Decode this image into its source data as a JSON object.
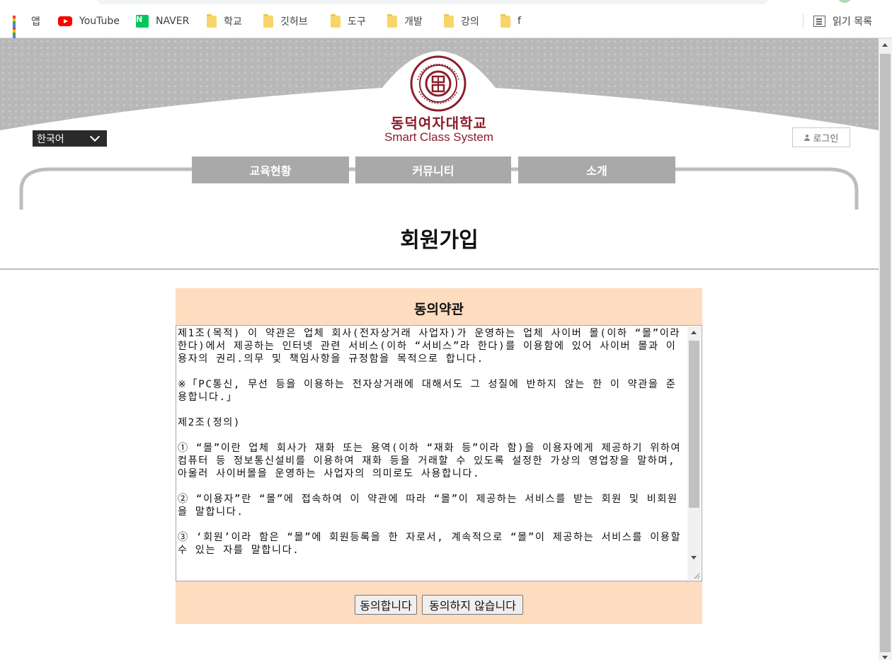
{
  "browser": {
    "bookmarks": [
      {
        "label": "앱",
        "icon": "apps-grid-icon"
      },
      {
        "label": "YouTube",
        "icon": "youtube-icon"
      },
      {
        "label": "NAVER",
        "icon": "naver-icon"
      },
      {
        "label": "학교",
        "icon": "folder-icon"
      },
      {
        "label": "깃허브",
        "icon": "folder-icon"
      },
      {
        "label": "도구",
        "icon": "folder-icon"
      },
      {
        "label": "개발",
        "icon": "folder-icon"
      },
      {
        "label": "강의",
        "icon": "folder-icon"
      },
      {
        "label": "f",
        "icon": "folder-icon"
      }
    ],
    "reading_list": "읽기 목록"
  },
  "header": {
    "school_name": "동덕여자대학교",
    "system_name": "Smart Class System",
    "language": "한국어",
    "login_label": "로그인",
    "nav": [
      "교육현황",
      "커뮤니티",
      "소개"
    ]
  },
  "page": {
    "title": "회원가입"
  },
  "agreement": {
    "title": "동의약관",
    "terms_text": "제1조(목적) 이 약관은 업체 회사(전자상거래 사업자)가 운영하는 업체 사이버 몰(이하 “몰”이라 한다)에서 제공하는 인터넷 관련 서비스(이하 “서비스”라 한다)를 이용함에 있어 사이버 몰과 이용자의 권리.의무 및 책임사항을 규정함을 목적으로 합니다.\n\n※「PC통신, 무선 등을 이용하는 전자상거래에 대해서도 그 성질에 반하지 않는 한 이 약관을 준용합니다.」\n\n제2조(정의)\n\n① “몰”이란 업체 회사가 재화 또는 용역(이하 “재화 등”이라 함)을 이용자에게 제공하기 위하여 컴퓨터 등 정보통신설비를 이용하여 재화 등을 거래할 수 있도록 설정한 가상의 영업장을 말하며, 아울러 사이버몰을 운영하는 사업자의 의미로도 사용합니다.\n\n② “이용자”란 “몰”에 접속하여 이 약관에 따라 “몰”이 제공하는 서비스를 받는 회원 및 비회원을 말합니다.\n\n③ ‘회원’이라 함은 “몰”에 회원등록을 한 자로서, 계속적으로 “몰”이 제공하는 서비스를 이용할 수 있는 자를 말합니다.",
    "agree_button": "동의합니다",
    "disagree_button": "동의하지 않습니다"
  },
  "colors": {
    "brand": "#8c1d2c",
    "agreement_bg": "#fddcbf",
    "nav_tab": "#a9a9a9"
  }
}
